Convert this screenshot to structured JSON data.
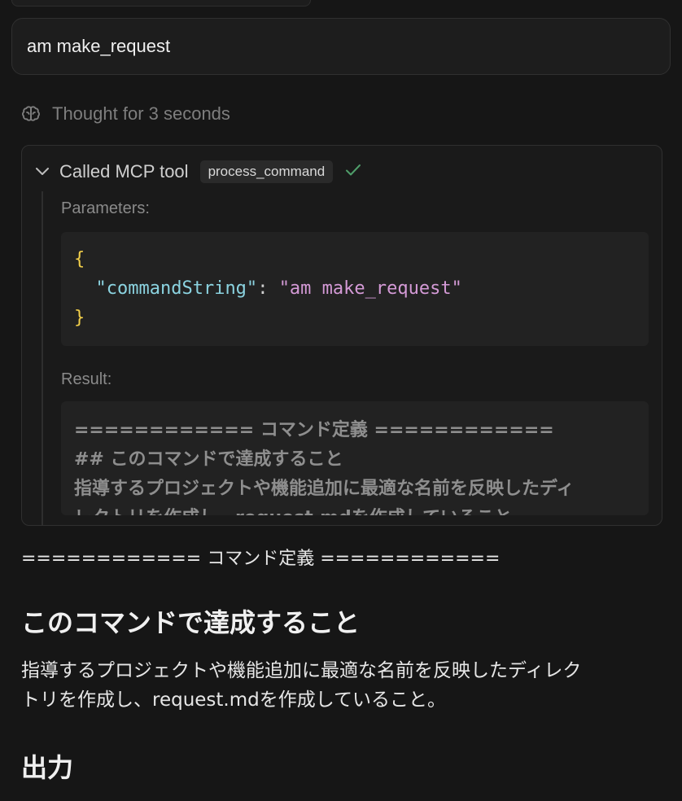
{
  "user_message": "am make_request",
  "thought": {
    "label": "Thought for 3 seconds",
    "icon": "brain-icon"
  },
  "tool_call": {
    "label": "Called MCP tool",
    "tool_name": "process_command",
    "status_icon": "check-icon",
    "status_color": "#4f9e6a",
    "parameters_label": "Parameters:",
    "params": {
      "open": "{",
      "key": "\"commandString\"",
      "colon": ":",
      "value": "\"am make_request\"",
      "close": "}"
    },
    "result_label": "Result:",
    "result_lines": [
      "============ コマンド定義 ============",
      "## このコマンドで達成すること",
      "指導するプロジェクトや機能追加に最適な名前を反映したディ",
      "レクトリを作成し、request.mdを作成していること。"
    ]
  },
  "markdown": {
    "rule_line": "============ コマンド定義 ============",
    "heading1": "このコマンドで達成すること",
    "paragraph_line1": "指導するプロジェクトや機能追加に最適な名前を反映したディレク",
    "paragraph_line2": "トリを作成し、request.mdを作成していること。",
    "heading2": "出力"
  },
  "colors": {
    "background": "#161616",
    "brace": "#f2cf4a",
    "json_key": "#8bd3e0",
    "json_string": "#d49ad6"
  }
}
